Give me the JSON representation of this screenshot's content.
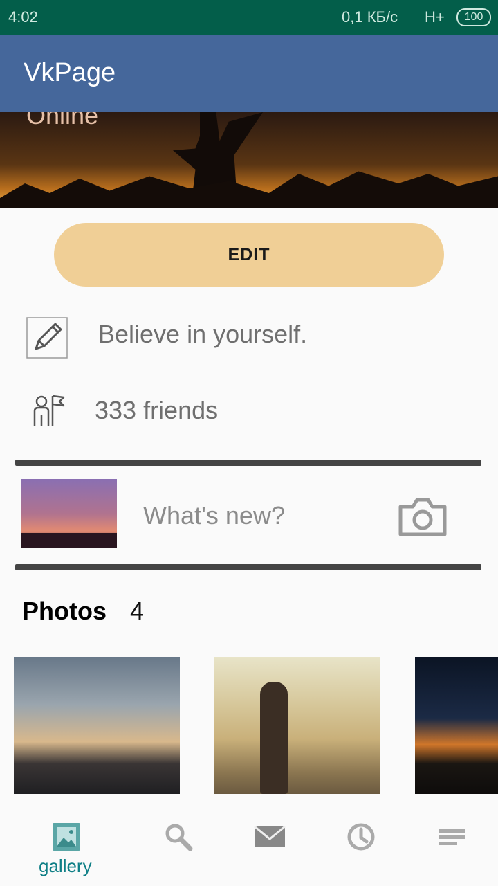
{
  "status_bar": {
    "time": "4:02",
    "speed": "0,1 КБ/с",
    "network": "H+",
    "battery": "100"
  },
  "app_bar": {
    "title": "VkPage"
  },
  "profile": {
    "online_label": "Online",
    "edit_label": "EDIT",
    "status": "Believe in yourself.",
    "friends": "333 friends"
  },
  "post": {
    "placeholder": "What's new?"
  },
  "photos": {
    "label": "Photos",
    "count": "4"
  },
  "bottom_nav": {
    "items": [
      {
        "label": "gallery",
        "icon": "gallery-icon"
      },
      {
        "label": "",
        "icon": "search-icon"
      },
      {
        "label": "",
        "icon": "mail-icon"
      },
      {
        "label": "",
        "icon": "clock-icon"
      },
      {
        "label": "",
        "icon": "menu-icon"
      }
    ]
  },
  "colors": {
    "status_bar": "#035e4a",
    "app_bar": "#45679b",
    "edit_button": "#f0cf96",
    "accent": "#0f7f86"
  }
}
